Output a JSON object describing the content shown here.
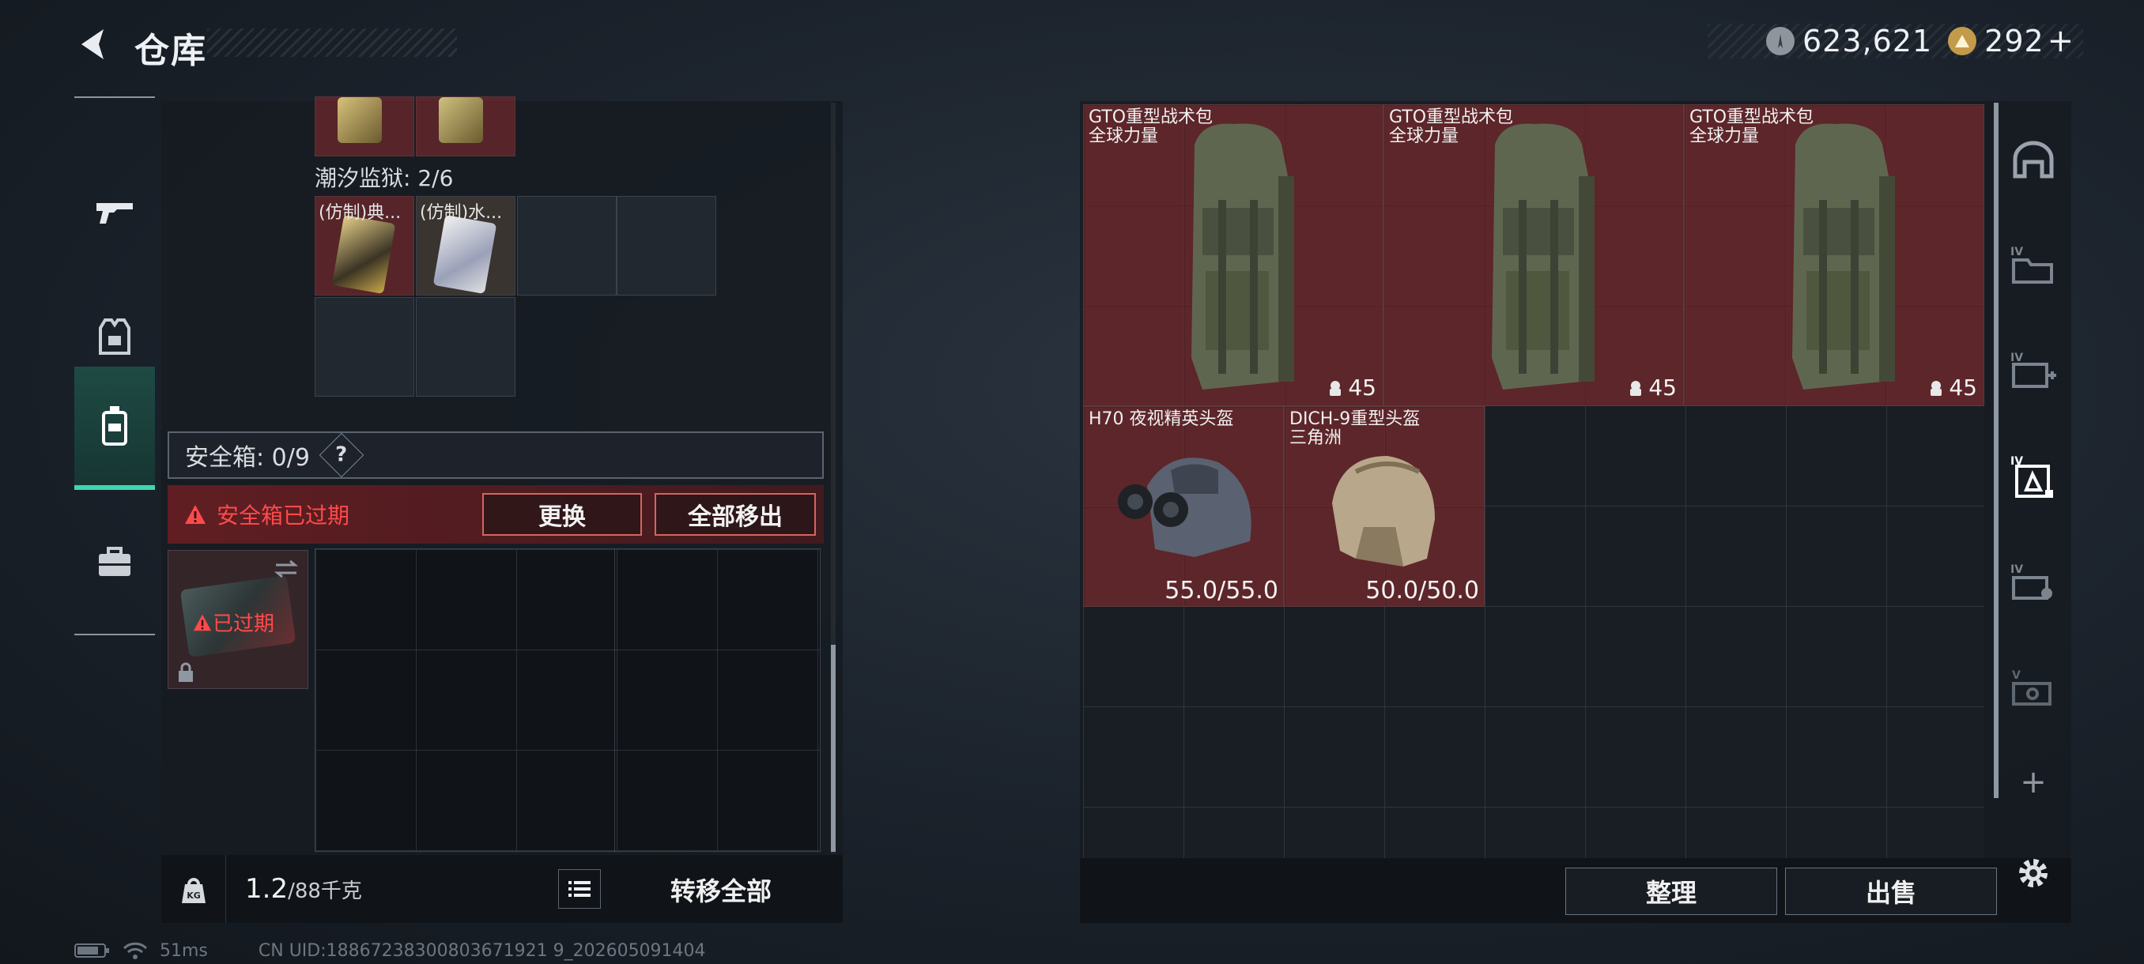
{
  "header": {
    "title": "仓库",
    "currency": [
      {
        "icon": "coin-icon",
        "value": "623,621"
      },
      {
        "icon": "triangle-coin-icon",
        "value": "292"
      }
    ],
    "add_label": "+"
  },
  "left_nav": [
    "weapon-icon",
    "armor-icon",
    "backpack-icon",
    "case-icon"
  ],
  "left_panel": {
    "prison_label": "潮汐监狱: 2/6",
    "prison_items": [
      {
        "label": "(仿制)典..."
      },
      {
        "label": "(仿制)水..."
      }
    ],
    "safe_box_label": "安全箱: 0/9",
    "help_label": "?",
    "expired_notice": "安全箱已过期",
    "replace_button": "更换",
    "remove_all_button": "全部移出",
    "safe_item_status": "已过期",
    "weight_value": "1.2",
    "weight_capacity": "/88千克",
    "transfer_all_button": "转移全部"
  },
  "status_bar": {
    "latency": "51ms",
    "uid": "CN UID:18867238300803671921 9_202605091404"
  },
  "stash": {
    "backpacks": [
      {
        "name": "GTO重型战术包",
        "faction": "全球力量",
        "count": "45"
      },
      {
        "name": "GTO重型战术包",
        "faction": "全球力量",
        "count": "45"
      },
      {
        "name": "GTO重型战术包",
        "faction": "全球力量",
        "count": "45"
      }
    ],
    "helmets": [
      {
        "name": "H70 夜视精英头盔",
        "faction": "",
        "durability": "55.0/55.0"
      },
      {
        "name": "DICH-9重型头盔",
        "faction": "三角洲",
        "durability": "50.0/50.0"
      }
    ],
    "sort_button": "整理",
    "sell_button": "出售"
  },
  "right_nav": [
    "helmet-nav-icon",
    "folder-iv-icon",
    "medkit-iv-icon",
    "armor-iv-icon",
    "case-iv-icon",
    "case-v-icon"
  ],
  "right_nav_add": "+"
}
